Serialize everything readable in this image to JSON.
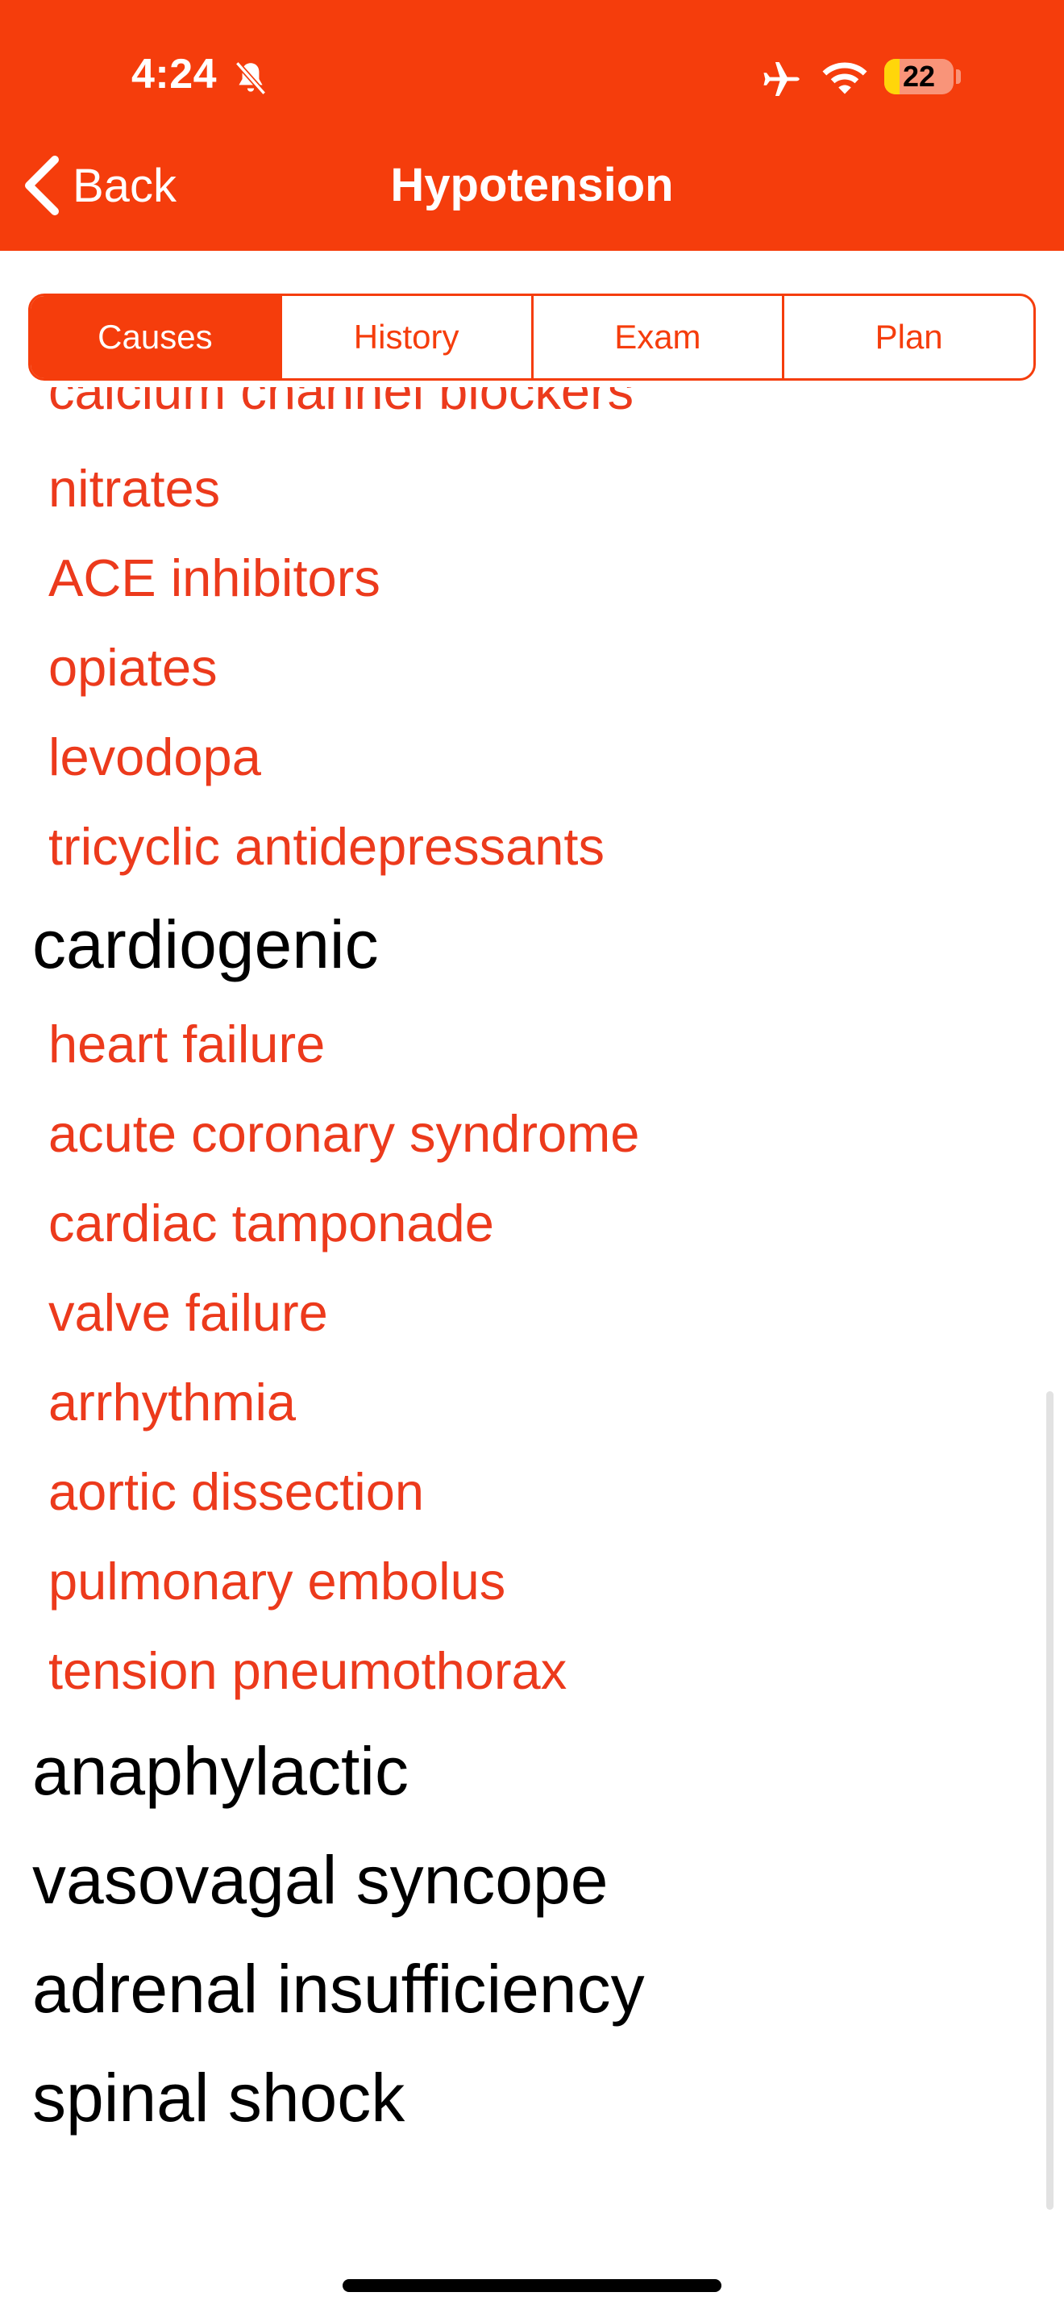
{
  "status_bar": {
    "time": "4:24",
    "battery": "22",
    "battery_level": 0.22
  },
  "nav": {
    "back_label": "Back",
    "title": "Hypotension"
  },
  "tabs": [
    {
      "label": "Causes",
      "active": true
    },
    {
      "label": "History",
      "active": false
    },
    {
      "label": "Exam",
      "active": false
    },
    {
      "label": "Plan",
      "active": false
    }
  ],
  "colors": {
    "accent": "#f53d0c",
    "item_text": "#ec3a1c",
    "heading_text": "#000000"
  },
  "list": {
    "partial_item": "calcium channel blockers",
    "drug_items": [
      "nitrates",
      "ACE inhibitors",
      "opiates",
      "levodopa",
      "tricyclic antidepressants"
    ],
    "cardiogenic_heading": "cardiogenic",
    "cardiogenic_items": [
      "heart failure",
      "acute coronary syndrome",
      "cardiac tamponade",
      "valve failure",
      "arrhythmia",
      "aortic dissection",
      "pulmonary embolus",
      "tension pneumothorax"
    ],
    "other_headings": [
      "anaphylactic",
      "vasovagal syncope",
      "adrenal insufficiency",
      "spinal shock"
    ]
  }
}
